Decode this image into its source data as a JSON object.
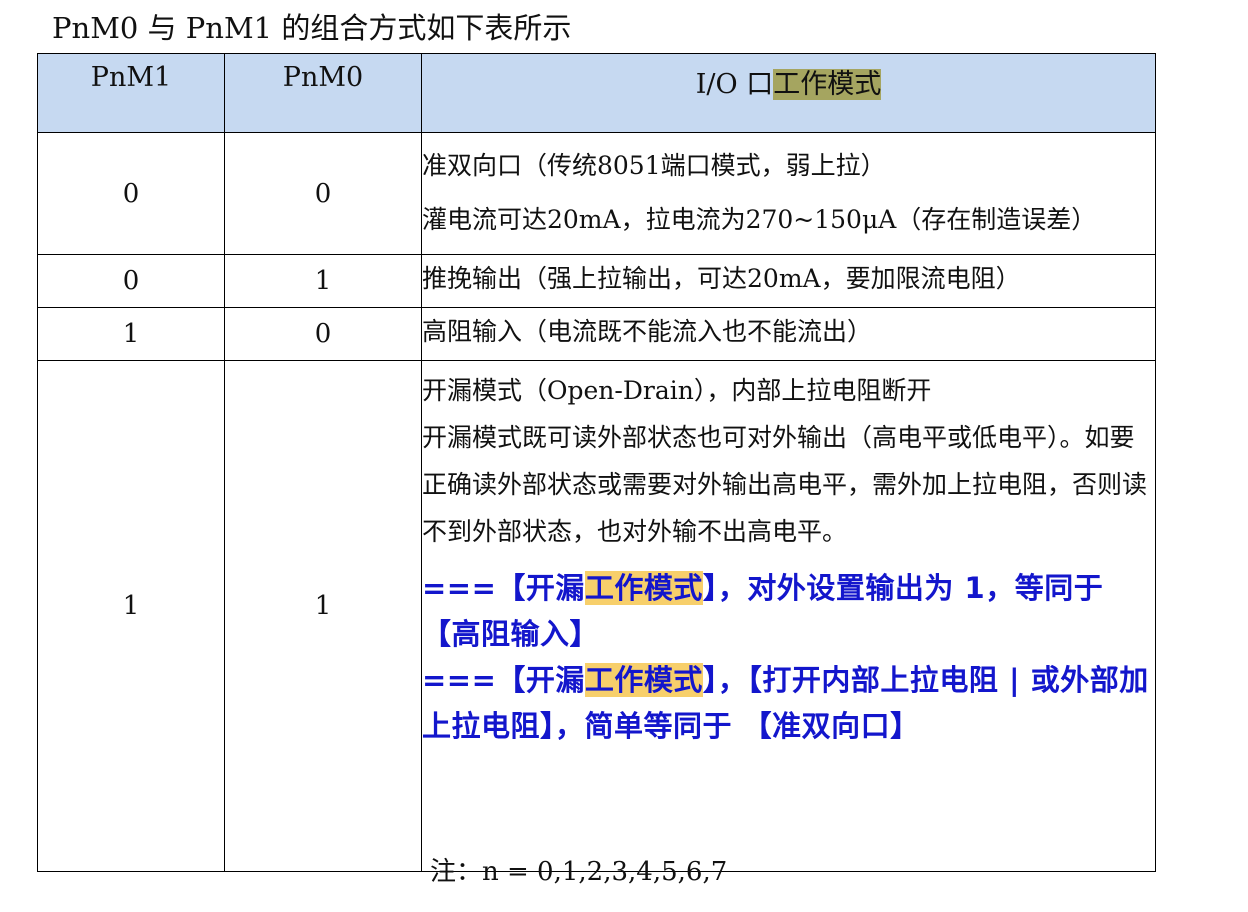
{
  "caption": "PnM0 与 PnM1 的组合方式如下表所示",
  "table": {
    "headers": {
      "pnm1": "PnM1",
      "pnm0": "PnM0",
      "mode_prefix": "I/O 口",
      "mode_highlight": "工作模式"
    },
    "rows": [
      {
        "pnm1": "0",
        "pnm0": "0",
        "lines": [
          "准双向口（传统8051端口模式，弱上拉）",
          "灌电流可达20mA，拉电流为270~150μA（存在制造误差）"
        ]
      },
      {
        "pnm1": "0",
        "pnm0": "1",
        "lines": [
          "推挽输出（强上拉输出，可达20mA，要加限流电阻）"
        ]
      },
      {
        "pnm1": "1",
        "pnm0": "0",
        "lines": [
          "高阻输入（电流既不能流入也不能流出）"
        ]
      },
      {
        "pnm1": "1",
        "pnm0": "1",
        "lines": [
          "开漏模式（Open-Drain），内部上拉电阻断开",
          "开漏模式既可读外部状态也可对外输出（高电平或低电平）。如要正确读外部状态或需要对外输出高电平，需外加上拉电阻，否则读不到外部状态，也对外输不出高电平。"
        ],
        "notes": [
          {
            "before": "===【开漏",
            "highlight": "工作模式",
            "after": "】，对外设置输出为 1，等同于 【高阻输入】"
          },
          {
            "before": "===【开漏",
            "highlight": "工作模式",
            "after": "】，【打开内部上拉电阻 | 或外部加上拉电阻】，简单等同于 【准双向口】"
          }
        ]
      }
    ]
  },
  "footnote": "注：n = 0,1,2,3,4,5,6,7",
  "colors": {
    "header_bg": "#c6d9f1",
    "header_highlight": "#a5a560",
    "note_highlight": "#f7cf6b",
    "note_text": "#1316cc"
  }
}
